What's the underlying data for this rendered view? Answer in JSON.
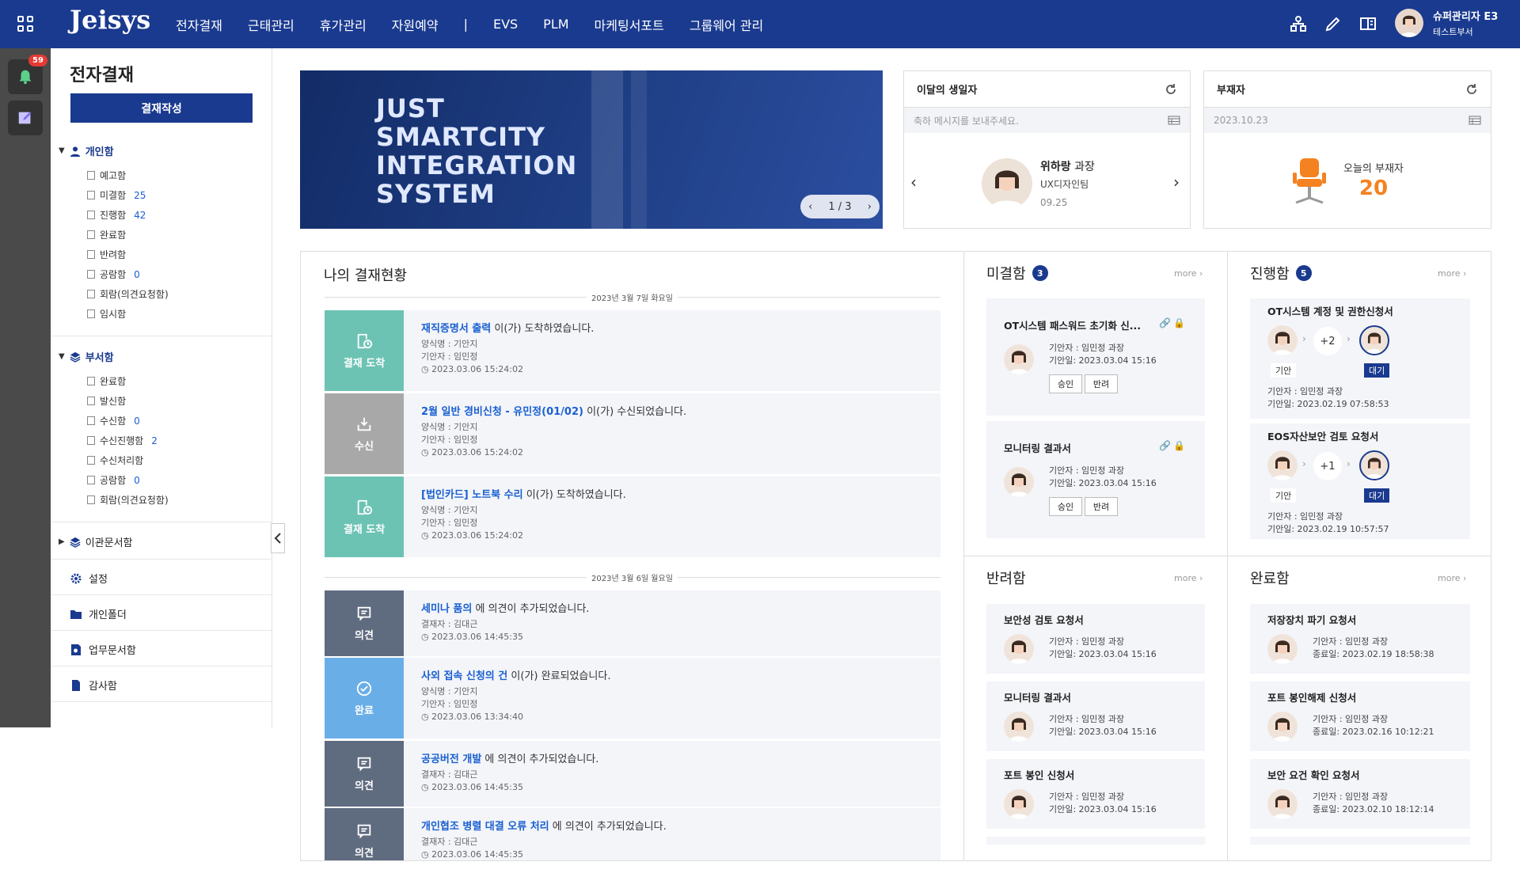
{
  "app": {
    "logo": "Jeisys"
  },
  "nav": [
    "전자결재",
    "근태관리",
    "휴가관리",
    "자원예약",
    "|",
    "EVS",
    "PLM",
    "마케팅서포트",
    "그룹웨어 관리"
  ],
  "user": {
    "name": "슈퍼관리자 E3",
    "dept": "테스트부서"
  },
  "rail": {
    "notif_count": "59"
  },
  "sidebar": {
    "title": "전자결재",
    "write_btn": "결재작성",
    "personal": {
      "label": "개인함",
      "items": [
        {
          "label": "예고함",
          "count": ""
        },
        {
          "label": "미결함",
          "count": "25"
        },
        {
          "label": "진행함",
          "count": "42"
        },
        {
          "label": "완료함",
          "count": ""
        },
        {
          "label": "반려함",
          "count": ""
        },
        {
          "label": "공람함",
          "count": "0"
        },
        {
          "label": "회람(의견요청함)",
          "count": ""
        },
        {
          "label": "임시함",
          "count": ""
        }
      ]
    },
    "dept": {
      "label": "부서함",
      "items": [
        {
          "label": "완료함",
          "count": ""
        },
        {
          "label": "발신함",
          "count": ""
        },
        {
          "label": "수신함",
          "count": "0"
        },
        {
          "label": "수신진행함",
          "count": "2"
        },
        {
          "label": "수신처리함",
          "count": ""
        },
        {
          "label": "공람함",
          "count": "0"
        },
        {
          "label": "회람(의견요청함)",
          "count": ""
        }
      ]
    },
    "related": "이관문서함",
    "menus": [
      "설정",
      "개인폴더",
      "업무문서함",
      "감사함"
    ]
  },
  "banner": {
    "lines": [
      "JUST",
      "SMARTCITY",
      "INTEGRATION",
      "SYSTEM"
    ],
    "page": "1 / 3"
  },
  "birthday": {
    "title": "이달의 생일자",
    "placeholder": "축하 메시지를 보내주세요.",
    "name": "위하랑",
    "rank": "과장",
    "team": "UX디자인팀",
    "date": "09.25"
  },
  "absent": {
    "title": "부재자",
    "date": "2023.10.23",
    "label": "오늘의 부재자",
    "count": "20"
  },
  "my_status": {
    "title": "나의 결재현황",
    "groups": [
      {
        "date": "2023년 3월 7일 화요일",
        "rows": [
          {
            "tag": "결재 도착",
            "subject": "재직증명서 출력",
            "suffix": " 이(가) 도착하였습니다.",
            "m1": "양식명 : 기안지",
            "m2": "기안자 : 임민정",
            "time": "2023.03.06 15:24:02",
            "color": "#6cc3b4"
          },
          {
            "tag": "수신",
            "subject": "2월 일반 경비신청 - 유민정(01/02)",
            "suffix": " 이(가) 수신되었습니다.",
            "m1": "양식명 : 기안지",
            "m2": "기안자 : 임민정",
            "time": "2023.03.06 15:24:02",
            "color": "#a8a8a8"
          },
          {
            "tag": "결재 도착",
            "subject": "[법인카드] 노트북 수리",
            "suffix": " 이(가) 도착하였습니다.",
            "m1": "양식명 : 기안지",
            "m2": "기안자 : 임민정",
            "time": "2023.03.06 15:24:02",
            "color": "#6cc3b4"
          }
        ]
      },
      {
        "date": "2023년 3월 6일 월요일",
        "rows": [
          {
            "tag": "의견",
            "subject": "세미나 품의",
            "suffix": " 에 의견이 추가되었습니다.",
            "m1": "결재자 : 김대근",
            "m2": "",
            "time": "2023.03.06 14:45:35",
            "color": "#5f6b7f"
          },
          {
            "tag": "완료",
            "subject": "사외 접속 신청의 건",
            "suffix": " 이(가) 완료되었습니다.",
            "m1": "양식명 : 기안지",
            "m2": "기안자 : 임민정",
            "time": "2023.03.06 13:34:40",
            "color": "#6aaee8"
          },
          {
            "tag": "의견",
            "subject": "공공버전 개발",
            "suffix": " 에 의견이 추가되었습니다.",
            "m1": "결재자 : 김대근",
            "m2": "",
            "time": "2023.03.06 14:45:35",
            "color": "#5f6b7f"
          },
          {
            "tag": "의견",
            "subject": "개인협조 병렬 대결 오류 처리",
            "suffix": " 에 의견이 추가되었습니다.",
            "m1": "결재자 : 김대근",
            "m2": "",
            "time": "2023.03.06 14:45:35",
            "color": "#5f6b7f"
          }
        ]
      }
    ]
  },
  "pending": {
    "title": "미결함",
    "count": "3",
    "more": "more",
    "approve": "승인",
    "reject": "반려",
    "items": [
      {
        "title": "OT시스템 패스워드 초기화 신...",
        "drafter": "기안자 : 임민정 과장",
        "date": "기안일: 2023.03.04 15:16"
      },
      {
        "title": "모니터링 결과서",
        "drafter": "기안자 : 임민정 과장",
        "date": "기안일: 2023.03.04 15:16"
      }
    ]
  },
  "progress": {
    "title": "진행함",
    "count": "5",
    "more": "more",
    "draft_tag": "기안",
    "wait_tag": "대기",
    "items": [
      {
        "title": "OT시스템 계정 및 권한신청서",
        "plus": "+2",
        "drafter": "기안자 : 임민정 과장",
        "date": "기안일: 2023.02.19 07:58:53"
      },
      {
        "title": "EOS자산보안 검토 요청서",
        "plus": "+1",
        "drafter": "기안자 : 임민정 과장",
        "date": "기안일: 2023.02.19 10:57:57"
      }
    ]
  },
  "rejected": {
    "title": "반려함",
    "more": "more",
    "items": [
      {
        "title": "보안성 검토 요청서",
        "drafter": "기안자 : 임민정 과장",
        "date": "기안일: 2023.03.04 15:16"
      },
      {
        "title": "모니터링 결과서",
        "drafter": "기안자 : 임민정 과장",
        "date": "기안일: 2023.03.04 15:16"
      },
      {
        "title": "포트 봉인 신청서",
        "drafter": "기안자 : 임민정 과장",
        "date": "기안일: 2023.03.04 15:16"
      }
    ]
  },
  "done": {
    "title": "완료함",
    "more": "more",
    "items": [
      {
        "title": "저장장치 파기 요청서",
        "drafter": "기안자 : 임민정 과장",
        "date": "종료일: 2023.02.19 18:58:38"
      },
      {
        "title": "포트 봉인해제 신청서",
        "drafter": "기안자 : 임민정 과장",
        "date": "종료일: 2023.02.16 10:12:21"
      },
      {
        "title": "보안 요건 확인 요청서",
        "drafter": "기안자 : 임민정 과장",
        "date": "종료일: 2023.02.10 18:12:14"
      }
    ]
  }
}
